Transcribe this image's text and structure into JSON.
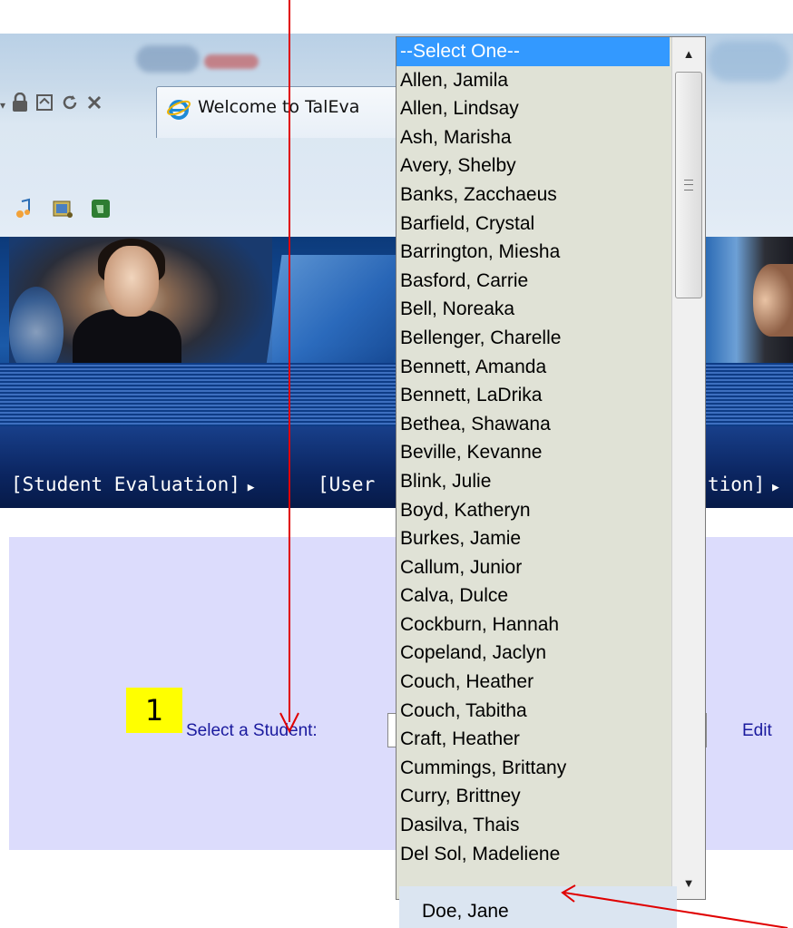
{
  "browser": {
    "tab_title": "Welcome to TalEva",
    "toolbar_icons": [
      "lock-icon",
      "compatibility-icon",
      "refresh-icon",
      "stop-icon"
    ]
  },
  "nav": {
    "item_left": "[Student Evaluation]",
    "item_middle": "[User",
    "item_right": "tion]"
  },
  "form": {
    "step_number": "1",
    "select_label": "Select a Student:",
    "edit_link": "Edit"
  },
  "dropdown": {
    "selected": "--Select One--",
    "options": [
      "--Select One--",
      "Allen, Jamila",
      "Allen, Lindsay",
      "Ash, Marisha",
      "Avery, Shelby",
      "Banks, Zacchaeus",
      "Barfield, Crystal",
      "Barrington, Miesha",
      "Basford, Carrie",
      "Bell, Noreaka",
      "Bellenger, Charelle",
      "Bennett, Amanda",
      "Bennett, LaDrika",
      "Bethea, Shawana",
      "Beville, Kevanne",
      "Blink, Julie",
      "Boyd, Katheryn",
      "Burkes, Jamie",
      "Callum, Junior",
      "Calva, Dulce",
      "Cockburn, Hannah",
      "Copeland, Jaclyn",
      "Couch, Heather",
      "Couch, Tabitha",
      "Craft, Heather",
      "Cummings, Brittany",
      "Curry, Brittney",
      "Dasilva, Thais",
      "Del Sol, Madeliene"
    ]
  },
  "callout": {
    "text": "Doe, Jane"
  },
  "colors": {
    "selection": "#3399ff",
    "content_bg": "#dcdcfc",
    "link": "#1a1a9e",
    "annotation_arrow": "#e00000",
    "highlight": "#ffff00"
  }
}
